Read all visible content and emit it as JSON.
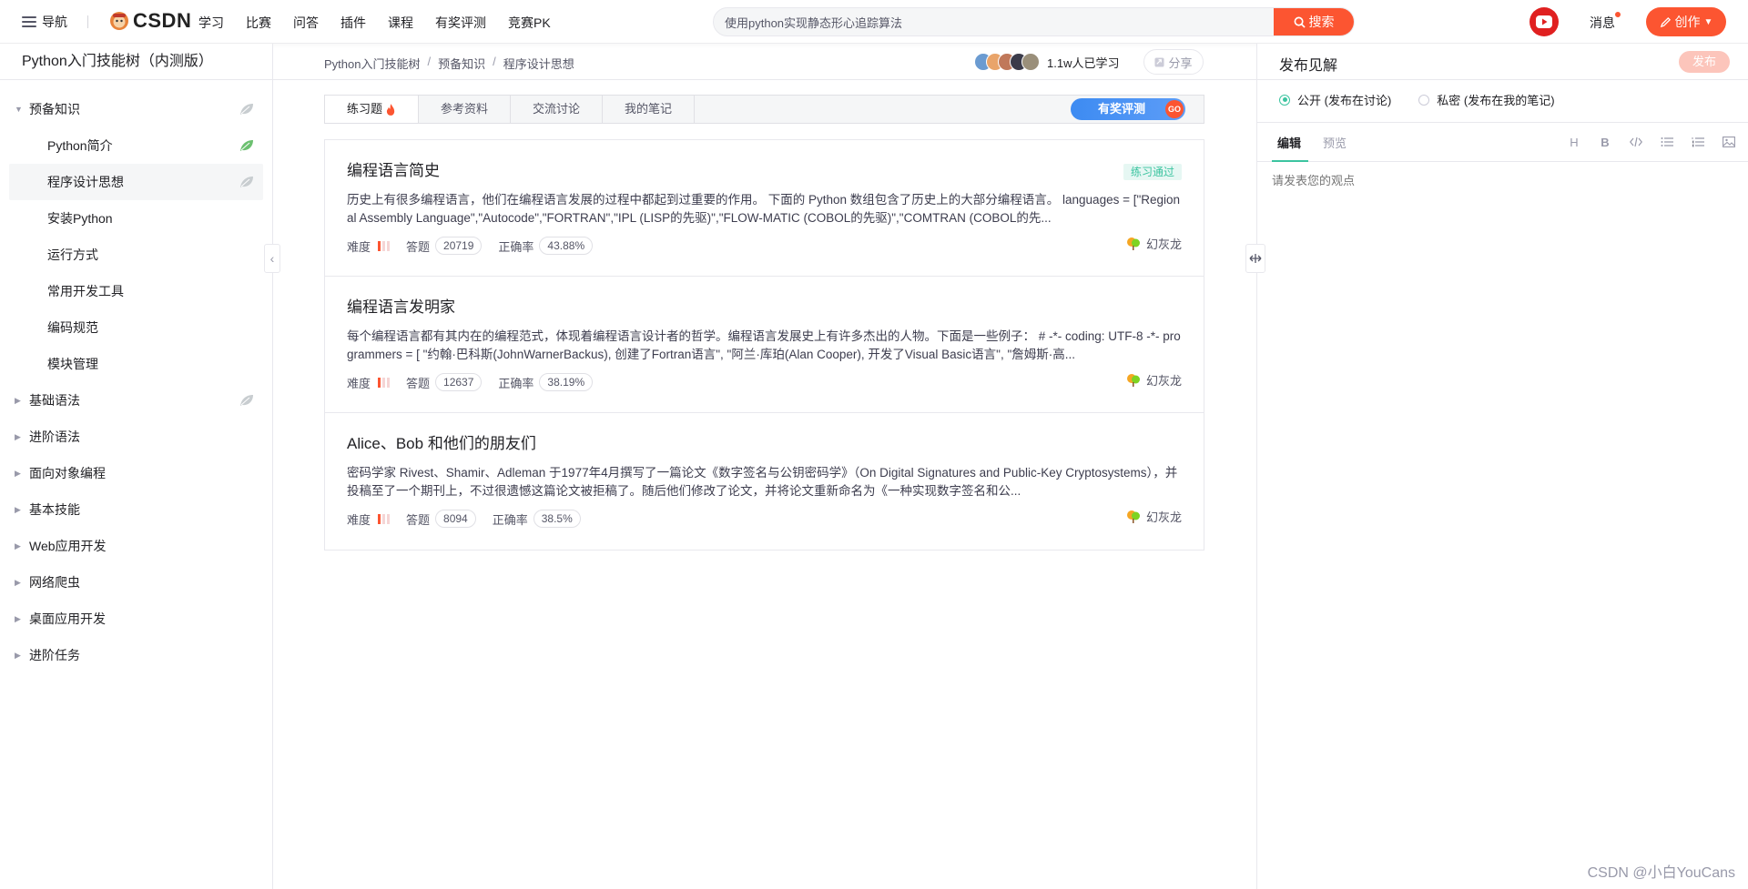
{
  "topbar": {
    "nav_label": "导航",
    "logo_text": "CSDN",
    "nav_items": [
      "学习",
      "比赛",
      "问答",
      "插件",
      "课程",
      "有奖评测",
      "竞赛PK"
    ],
    "search_value": "使用python实现静态形心追踪算法",
    "search_button": "搜索",
    "messages_label": "消息",
    "create_label": "创作"
  },
  "sidebar": {
    "title": "Python入门技能树（内测版）",
    "items": [
      {
        "label": "预备知识",
        "level": 0,
        "expanded": true,
        "leaf": "gray"
      },
      {
        "label": "Python简介",
        "level": 1,
        "leaf": "green"
      },
      {
        "label": "程序设计思想",
        "level": 1,
        "active": true,
        "leaf": "gray"
      },
      {
        "label": "安装Python",
        "level": 1
      },
      {
        "label": "运行方式",
        "level": 1
      },
      {
        "label": "常用开发工具",
        "level": 1
      },
      {
        "label": "编码规范",
        "level": 1
      },
      {
        "label": "模块管理",
        "level": 1
      },
      {
        "label": "基础语法",
        "level": 0,
        "leaf": "gray"
      },
      {
        "label": "进阶语法",
        "level": 0
      },
      {
        "label": "面向对象编程",
        "level": 0
      },
      {
        "label": "基本技能",
        "level": 0
      },
      {
        "label": "Web应用开发",
        "level": 0
      },
      {
        "label": "网络爬虫",
        "level": 0
      },
      {
        "label": "桌面应用开发",
        "level": 0
      },
      {
        "label": "进阶任务",
        "level": 0
      }
    ]
  },
  "breadcrumb": [
    "Python入门技能树",
    "预备知识",
    "程序设计思想"
  ],
  "learners": "1.1w人已学习",
  "share_label": "分享",
  "tabs": [
    "练习题",
    "参考资料",
    "交流讨论",
    "我的笔记"
  ],
  "reward_label": "有奖评测",
  "reward_go": "GO",
  "meta_labels": {
    "difficulty": "难度",
    "answers": "答题",
    "accuracy": "正确率"
  },
  "cards": [
    {
      "title": "编程语言简史",
      "badge": "练习通过",
      "desc": "历史上有很多编程语言，他们在编程语言发展的过程中都起到过重要的作用。 下面的 Python 数组包含了历史上的大部分编程语言。 languages = [\"Regional Assembly Language\",\"Autocode\",\"FORTRAN\",\"IPL (LISP的先驱)\",\"FLOW-MATIC (COBOL的先驱)\",\"COMTRAN (COBOL的先...",
      "difficulty_level": 1,
      "answers": "20719",
      "accuracy": "43.88%",
      "author": "幻灰龙"
    },
    {
      "title": "编程语言发明家",
      "badge": "",
      "desc": "每个编程语言都有其内在的编程范式，体现着编程语言设计者的哲学。编程语言发展史上有许多杰出的人物。下面是一些例子： # -*- coding: UTF-8 -*- programmers = [ \"约翰·巴科斯(JohnWarnerBackus), 创建了Fortran语言\", \"阿兰·库珀(Alan Cooper), 开发了Visual Basic语言\", \"詹姆斯·高...",
      "difficulty_level": 1,
      "answers": "12637",
      "accuracy": "38.19%",
      "author": "幻灰龙"
    },
    {
      "title": "Alice、Bob 和他们的朋友们",
      "badge": "",
      "desc": "密码学家 Rivest、Shamir、Adleman 于1977年4月撰写了一篇论文《数字签名与公钥密码学》（On Digital Signatures and Public-Key Cryptosystems），并投稿至了一个期刊上，不过很遗憾这篇论文被拒稿了。随后他们修改了论文，并将论文重新命名为《一种实现数字签名和公...",
      "difficulty_level": 1,
      "answers": "8094",
      "accuracy": "38.5%",
      "author": "幻灰龙"
    }
  ],
  "right_panel": {
    "title": "发布见解",
    "publish_label": "发布",
    "visibility": [
      "公开 (发布在讨论)",
      "私密 (发布在我的笔记)"
    ],
    "editor_tabs": [
      "编辑",
      "预览"
    ],
    "placeholder": "请发表您的观点"
  },
  "watermark": "CSDN @小白YouCans",
  "colors": {
    "accent": "#fc5531",
    "green": "#3cc4a0",
    "blue": "#3d8bf2"
  }
}
